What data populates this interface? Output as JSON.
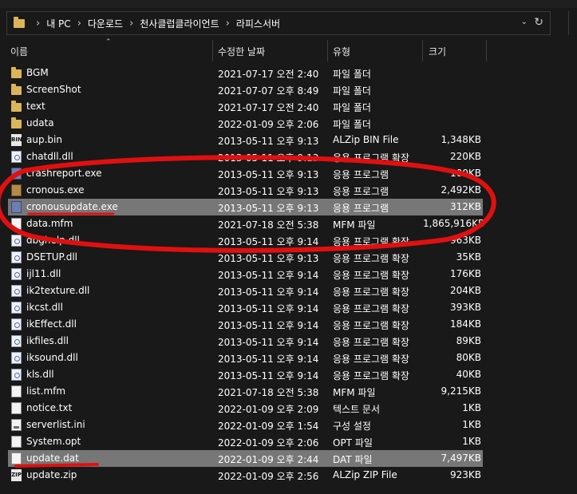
{
  "address": {
    "crumbs": [
      "내 PC",
      "다운로드",
      "천사클럽클라이언트",
      "라피스서버"
    ]
  },
  "columns": {
    "name": "이름",
    "date": "수정한 날짜",
    "type": "유형",
    "size": "크기"
  },
  "files": [
    {
      "name": "BGM",
      "date": "2021-07-17 오전 2:40",
      "type": "파일 폴더",
      "size": "",
      "icon": "folder-icon"
    },
    {
      "name": "ScreenShot",
      "date": "2021-07-07 오후 8:49",
      "type": "파일 폴더",
      "size": "",
      "icon": "folder-icon"
    },
    {
      "name": "text",
      "date": "2021-07-17 오전 2:40",
      "type": "파일 폴더",
      "size": "",
      "icon": "folder-icon"
    },
    {
      "name": "udata",
      "date": "2022-01-09 오후 2:06",
      "type": "파일 폴더",
      "size": "",
      "icon": "folder-icon"
    },
    {
      "name": "aup.bin",
      "date": "2013-05-11 오후 9:13",
      "type": "ALZip BIN File",
      "size": "1,348KB",
      "icon": "bin-file-icon"
    },
    {
      "name": "chatdll.dll",
      "date": "2013-05-11 오후 9:13",
      "type": "응용 프로그램 확장",
      "size": "220KB",
      "icon": "dll-file-icon"
    },
    {
      "name": "crashreport.exe",
      "date": "2013-05-11 오후 9:13",
      "type": "응용 프로그램",
      "size": "100KB",
      "icon": "exe-file-icon"
    },
    {
      "name": "cronous.exe",
      "date": "2013-05-11 오후 9:13",
      "type": "응용 프로그램",
      "size": "2,492KB",
      "icon": "exe-file-icon"
    },
    {
      "name": "cronousupdate.exe",
      "date": "2013-05-11 오후 9:13",
      "type": "응용 프로그램",
      "size": "312KB",
      "icon": "exe-file-icon",
      "selected": true
    },
    {
      "name": "data.mfm",
      "date": "2021-07-18 오전 5:38",
      "type": "MFM 파일",
      "size": "1,865,916KB",
      "icon": "file-icon"
    },
    {
      "name": "dbghelp.dll",
      "date": "2013-05-11 오후 9:14",
      "type": "응용 프로그램 확장",
      "size": "963KB",
      "icon": "dll-file-icon"
    },
    {
      "name": "DSETUP.dll",
      "date": "2013-05-11 오후 9:13",
      "type": "응용 프로그램 확장",
      "size": "35KB",
      "icon": "dll-file-icon"
    },
    {
      "name": "ijl11.dll",
      "date": "2013-05-11 오후 9:14",
      "type": "응용 프로그램 확장",
      "size": "176KB",
      "icon": "dll-file-icon"
    },
    {
      "name": "ik2texture.dll",
      "date": "2013-05-11 오후 9:14",
      "type": "응용 프로그램 확장",
      "size": "204KB",
      "icon": "dll-file-icon"
    },
    {
      "name": "ikcst.dll",
      "date": "2013-05-11 오후 9:14",
      "type": "응용 프로그램 확장",
      "size": "393KB",
      "icon": "dll-file-icon"
    },
    {
      "name": "ikEffect.dll",
      "date": "2013-05-11 오후 9:14",
      "type": "응용 프로그램 확장",
      "size": "184KB",
      "icon": "dll-file-icon"
    },
    {
      "name": "ikfiles.dll",
      "date": "2013-05-11 오후 9:14",
      "type": "응용 프로그램 확장",
      "size": "89KB",
      "icon": "dll-file-icon"
    },
    {
      "name": "iksound.dll",
      "date": "2013-05-11 오후 9:14",
      "type": "응용 프로그램 확장",
      "size": "80KB",
      "icon": "dll-file-icon"
    },
    {
      "name": "kls.dll",
      "date": "2013-05-11 오후 9:14",
      "type": "응용 프로그램 확장",
      "size": "40KB",
      "icon": "dll-file-icon"
    },
    {
      "name": "list.mfm",
      "date": "2021-07-18 오전 5:38",
      "type": "MFM 파일",
      "size": "9,215KB",
      "icon": "file-icon"
    },
    {
      "name": "notice.txt",
      "date": "2022-01-09 오후 2:09",
      "type": "텍스트 문서",
      "size": "1KB",
      "icon": "text-file-icon"
    },
    {
      "name": "serverlist.ini",
      "date": "2022-01-09 오후 1:54",
      "type": "구성 설정",
      "size": "1KB",
      "icon": "settings-file-icon"
    },
    {
      "name": "System.opt",
      "date": "2022-01-09 오후 2:06",
      "type": "OPT 파일",
      "size": "1KB",
      "icon": "file-icon"
    },
    {
      "name": "update.dat",
      "date": "2022-01-09 오후 2:44",
      "type": "DAT 파일",
      "size": "7,497KB",
      "icon": "file-icon",
      "selected": true
    },
    {
      "name": "update.zip",
      "date": "2022-01-09 오후 2:56",
      "type": "ALZip ZIP File",
      "size": "923KB",
      "icon": "zip-file-icon"
    }
  ],
  "icon_badges": {
    "bin": "BIN",
    "zip": "ZIP"
  },
  "colors": {
    "background": "#191919",
    "selection": "#777777",
    "annotation": "#e01010",
    "folder": "#dcb55a"
  }
}
